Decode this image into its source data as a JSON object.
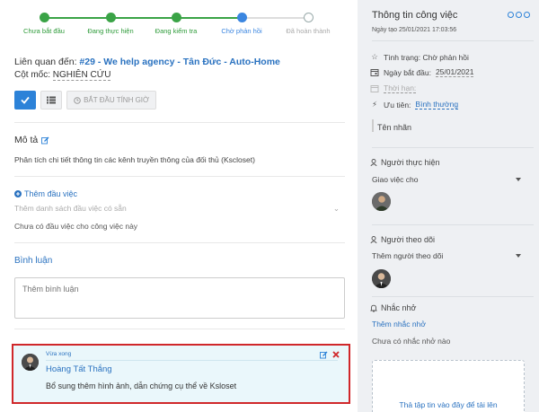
{
  "progress": {
    "steps": [
      {
        "label": "Chưa bắt đầu",
        "state": "done"
      },
      {
        "label": "Đang thực hiện",
        "state": "done"
      },
      {
        "label": "Đang kiểm tra",
        "state": "done"
      },
      {
        "label": "Chờ phản hồi",
        "state": "current"
      },
      {
        "label": "Đã hoàn thành",
        "state": "todo"
      }
    ]
  },
  "related": {
    "prefix": "Liên quan đến:",
    "link": "#29 - We help agency - Tân Đức - Auto-Home"
  },
  "milestone": {
    "label": "Cột mốc:",
    "value": "NGHIÊN CỨU"
  },
  "toolbar": {
    "timer_label": "BẮT ĐẦU TÍNH GIỜ"
  },
  "description": {
    "title": "Mô tả",
    "text": "Phân tích chi tiết thông tin các kênh truyền thông của đối thủ (Kscloset)"
  },
  "subtasks": {
    "add_label": "Thêm đầu việc",
    "select_placeholder": "Thêm danh sách đầu việc có sẵn",
    "empty_text": "Chưa có đầu việc cho công việc này"
  },
  "comments": {
    "title": "Bình luận",
    "input_placeholder": "Thêm bình luận",
    "items": [
      {
        "time": "Vừa xong",
        "author": "Hoàng Tất Thắng",
        "text": "Bổ sung thêm hình ảnh, dẫn chứng cụ thể về Ksloset"
      }
    ]
  },
  "sidebar": {
    "title": "Thông tin công việc",
    "created": "Ngày tạo 25/01/2021 17:03:56",
    "status": "Tình trạng: Chờ phản hồi",
    "start_label": "Ngày bắt đầu:",
    "start_value": "25/01/2021",
    "deadline_label": "Thời hạn:",
    "priority_label": "Ưu tiên:",
    "priority_value": "Bình thường",
    "tag_label": "Tên nhãn",
    "assignee_title": "Người thực hiện",
    "assignee_select": "Giao việc cho",
    "follower_title": "Người theo dõi",
    "follower_select": "Thêm người theo dõi",
    "reminder_title": "Nhắc nhở",
    "reminder_add": "Thêm nhắc nhở",
    "reminder_empty": "Chưa có nhắc nhở nào",
    "upload_text": "Thả tập tin vào đây để tải lên"
  },
  "colors": {
    "accent": "#2c82d8",
    "done": "#3aa346",
    "highlight_border": "#d0272a"
  }
}
